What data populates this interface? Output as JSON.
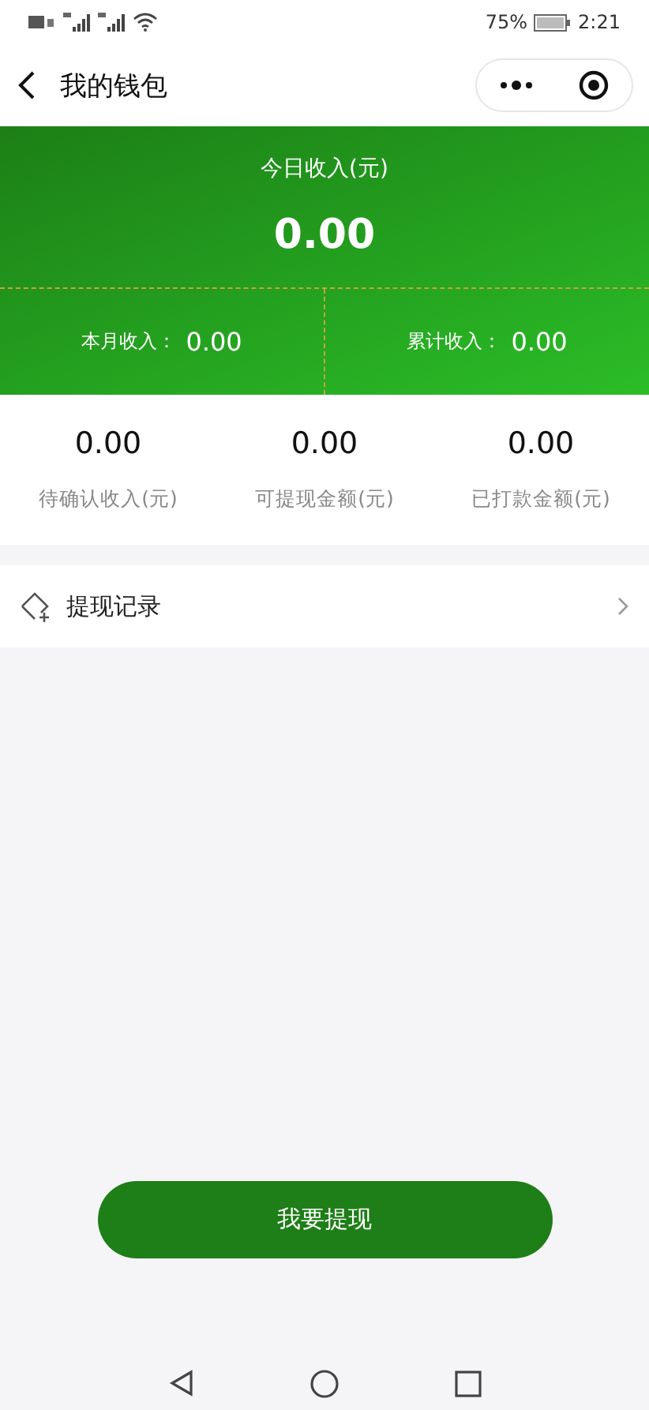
{
  "status_bar": {
    "battery": "75%",
    "time": "2:21"
  },
  "nav": {
    "title": "我的钱包"
  },
  "today": {
    "label": "今日收入(元)",
    "value": "0.00"
  },
  "summary": [
    {
      "label": "本月收入：",
      "value": "0.00"
    },
    {
      "label": "累计收入：",
      "value": "0.00"
    }
  ],
  "stats": [
    {
      "value": "0.00",
      "label": "待确认收入(元)"
    },
    {
      "value": "0.00",
      "label": "可提现金额(元)"
    },
    {
      "value": "0.00",
      "label": "已打款金额(元)"
    }
  ],
  "menu": [
    {
      "label": "提现记录"
    }
  ],
  "withdraw_button": "我要提现"
}
